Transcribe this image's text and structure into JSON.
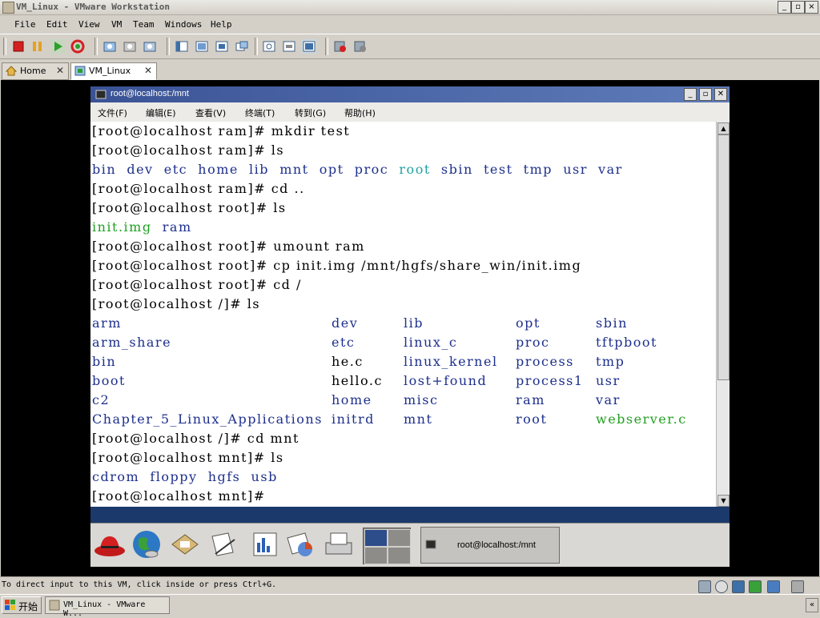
{
  "app": {
    "title": "VM_Linux - VMware Workstation",
    "menu": [
      "File",
      "Edit",
      "View",
      "VM",
      "Team",
      "Windows",
      "Help"
    ],
    "tabs": [
      {
        "label": "Home"
      },
      {
        "label": "VM_Linux"
      }
    ],
    "status_text": "To direct input to this VM, click inside or press Ctrl+G."
  },
  "taskbar": {
    "start_label": "开始",
    "item_label": "VM_Linux - VMware W..."
  },
  "guest": {
    "window_title": "root@localhost:/mnt",
    "menu": [
      "文件(F)",
      "编辑(E)",
      "查看(V)",
      "终端(T)",
      "转到(G)",
      "帮助(H)"
    ],
    "panel_task_label": "root@localhost:/mnt"
  },
  "terminal": {
    "lines": [
      "[root@localhost ram]# mkdir test",
      "[root@localhost ram]# ls",
      "",
      "[root@localhost ram]# cd ..",
      "[root@localhost root]# ls",
      "",
      "[root@localhost root]# umount ram",
      "[root@localhost root]# cp init.img /mnt/hgfs/share_win/init.img",
      "[root@localhost root]# cd /",
      "[root@localhost /]# ls"
    ],
    "ls_ram": {
      "dirs1": "bin  dev  etc  home  lib  mnt  opt  proc",
      "root": "root",
      "dirs2": "sbin  test  tmp  usr  var"
    },
    "ls_root": {
      "img": "init.img",
      "ram": "ram"
    },
    "ls_slash": [
      [
        "arm",
        "dev",
        "lib",
        "opt",
        "sbin"
      ],
      [
        "arm_share",
        "etc",
        "linux_c",
        "proc",
        "tftpboot"
      ],
      [
        "bin",
        "he.c",
        "linux_kernel",
        "process",
        "tmp"
      ],
      [
        "boot",
        "hello.c",
        "lost+found",
        "process1",
        "usr"
      ],
      [
        "c2",
        "home",
        "misc",
        "ram",
        "var"
      ],
      [
        "Chapter_5_Linux_Applications",
        "initrd",
        "mnt",
        "root",
        "webserver.c"
      ]
    ],
    "after_lines": [
      "[root@localhost /]# cd mnt",
      "[root@localhost mnt]# ls"
    ],
    "ls_mnt": "cdrom  floppy  hgfs  usb",
    "prompt": "[root@localhost mnt]# "
  },
  "colors": {
    "directory": "#1d2f8c",
    "executable": "#21a021",
    "link": "#22a0a0",
    "title_bar": "#3a5396"
  }
}
